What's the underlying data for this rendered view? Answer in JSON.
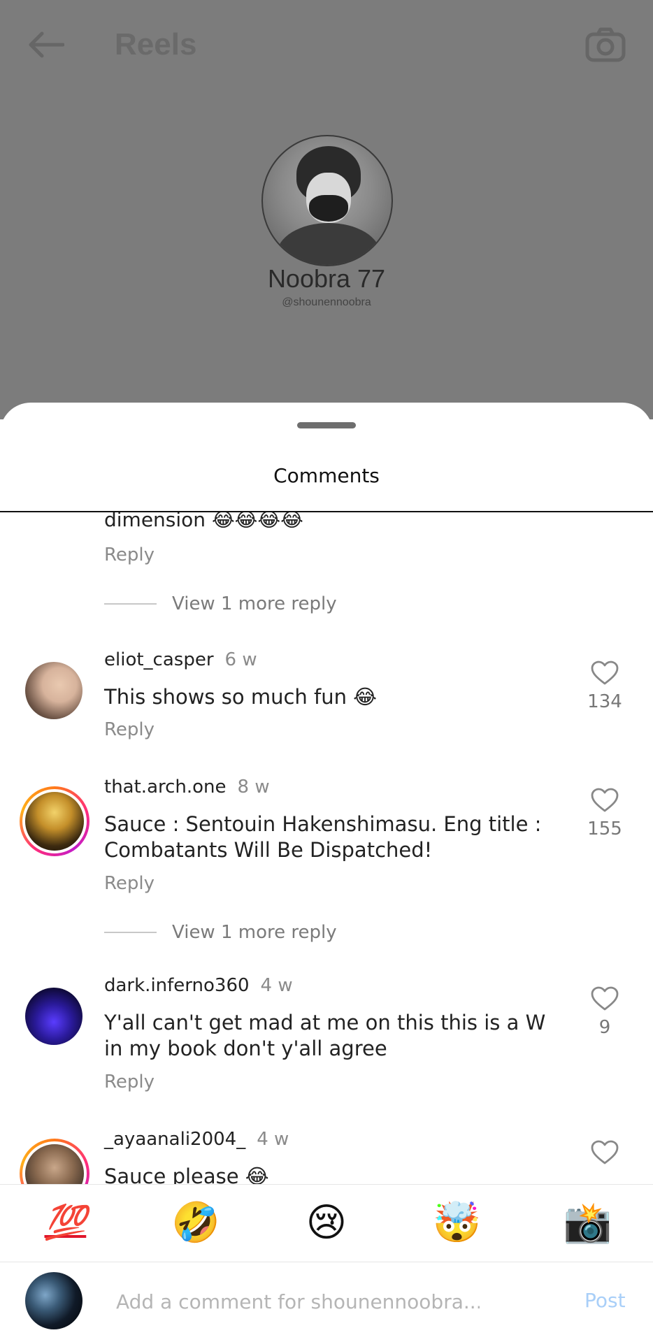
{
  "background": {
    "title": "Reels",
    "profile_name": "Noobra 77",
    "profile_handle": "@shounennoobra"
  },
  "sheet": {
    "title": "Comments"
  },
  "partial_comment": {
    "text": "dimension 😂😂😂😂",
    "reply_label": "Reply",
    "view_more_label": "View 1 more reply"
  },
  "comments": [
    {
      "username": "eliot_casper",
      "time": "6 w",
      "text": "This shows so much fun 😂",
      "likes": "134",
      "reply_label": "Reply"
    },
    {
      "username": "that.arch.one",
      "time": "8 w",
      "text": "Sauce : Sentouin Hakenshimasu. Eng title : Combatants Will Be Dispatched!",
      "likes": "155",
      "reply_label": "Reply",
      "view_more_label": "View 1 more reply"
    },
    {
      "username": "dark.inferno360",
      "time": "4 w",
      "text": "Y'all can't get mad at me on this  this is a W in my book don't y'all agree",
      "likes": "9",
      "reply_label": "Reply"
    },
    {
      "username": "_ayaanali2004_",
      "time": "4 w",
      "text": "Sauce please 😂",
      "likes": ""
    }
  ],
  "emoji_bar": {
    "hundred": "💯",
    "rofl": "🤣",
    "crying": "😢",
    "mind_blown": "🤯",
    "camera_flash": "📸"
  },
  "composer": {
    "placeholder": "Add a comment for shounennoobra...",
    "post_label": "Post",
    "post_color": "#a9cff8"
  },
  "colors": {
    "background_dim": "#7c7c7c",
    "story_ring_start": "#ff7a1a",
    "story_ring_end": "#c31bc9"
  }
}
